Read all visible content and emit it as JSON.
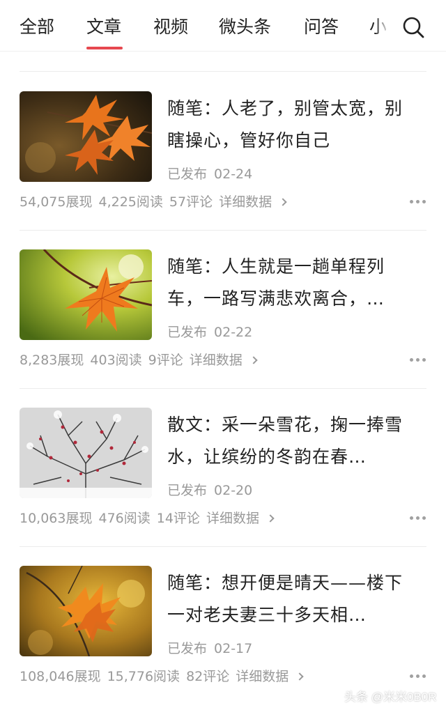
{
  "tabs": [
    {
      "label": "全部"
    },
    {
      "label": "文章"
    },
    {
      "label": "视频"
    },
    {
      "label": "微头条"
    },
    {
      "label": "问答"
    },
    {
      "label": "小"
    }
  ],
  "active_tab": "文章",
  "accent_color": "#e6484f",
  "search_icon": "search-icon",
  "articles": [
    {
      "title": "随笔：人老了，别管太宽，别瞎操心，管好你自己",
      "status": "已发布",
      "date": "02-24",
      "impressions": "54,075展现",
      "reads": "4,225阅读",
      "comments": "57评论",
      "detail_link": "详细数据",
      "thumbnail": "orange maple leaves"
    },
    {
      "title": "随笔：人生就是一趟单程列车，一路写满悲欢离合，…",
      "status": "已发布",
      "date": "02-22",
      "impressions": "8,283展现",
      "reads": "403阅读",
      "comments": "9评论",
      "detail_link": "详细数据",
      "thumbnail": "red maple leaf on green"
    },
    {
      "title": "散文：采一朵雪花，掬一捧雪水，让缤纷的冬韵在春…",
      "status": "已发布",
      "date": "02-20",
      "impressions": "10,063展现",
      "reads": "476阅读",
      "comments": "14评论",
      "detail_link": "详细数据",
      "thumbnail": "snow covered branches"
    },
    {
      "title": "随笔：想开便是晴天——楼下一对老夫妻三十多天相…",
      "status": "已发布",
      "date": "02-17",
      "impressions": "108,046展现",
      "reads": "15,776阅读",
      "comments": "82评论",
      "detail_link": "详细数据",
      "thumbnail": "autumn leaves on branch"
    }
  ],
  "watermark": "头条 @米米0B0R"
}
